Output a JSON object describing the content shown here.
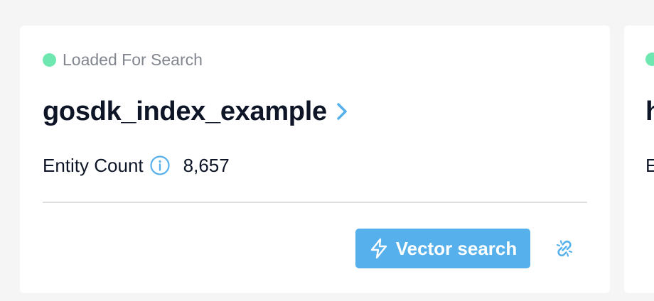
{
  "card": {
    "status": "Loaded For Search",
    "status_color": "#6ee7b0",
    "title": "gosdk_index_example",
    "entity_count_label": "Entity Count",
    "entity_count_value": "8,657",
    "vector_search_label": "Vector search",
    "accent_color": "#56b0ec",
    "icons": {
      "title_link": "chevron-right-icon",
      "count_info": "info-icon",
      "vector_search": "bolt-icon",
      "unlink": "unlink-icon"
    }
  },
  "next_card": {
    "title_partial": "h",
    "count_label_partial": "E"
  }
}
